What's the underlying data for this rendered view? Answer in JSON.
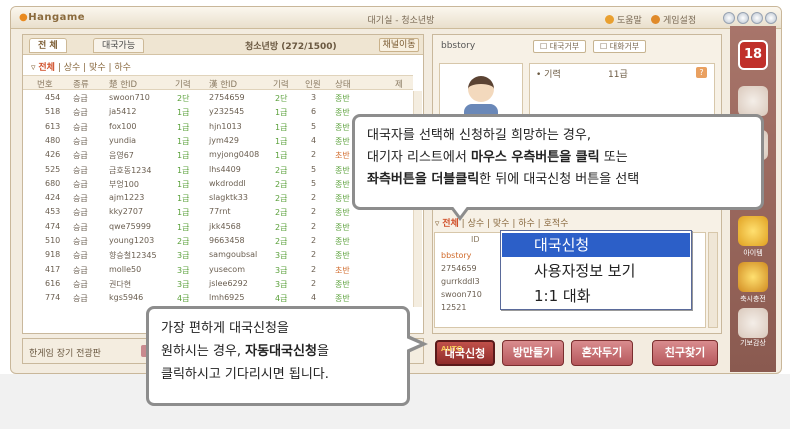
{
  "window": {
    "logo": "Hangame",
    "title": "대기실 - 청소년방",
    "help_link": "도움말",
    "settings_link": "게임설정"
  },
  "left_panel": {
    "tabs": [
      "전 체",
      "대국가능"
    ],
    "room_label": "청소년방 (272/1500)",
    "channel_button": "채널이동",
    "filter": {
      "all": "전체",
      "items": [
        "상수",
        "맞수",
        "하수"
      ]
    },
    "columns": [
      "번호",
      "종류",
      "楚 한ID",
      "기력",
      "漢 한ID",
      "기력",
      "인원",
      "상태",
      "제"
    ],
    "rows": [
      [
        "454",
        "승급",
        "swoon710",
        "2단",
        "2754659",
        "2단",
        "3",
        "종반"
      ],
      [
        "518",
        "승급",
        "ja5412",
        "1급",
        "y232545",
        "1급",
        "6",
        "종반"
      ],
      [
        "613",
        "승급",
        "fox100",
        "1급",
        "hjn1013",
        "1급",
        "5",
        "종반"
      ],
      [
        "480",
        "승급",
        "yundia",
        "1급",
        "jym429",
        "1급",
        "4",
        "종반"
      ],
      [
        "426",
        "승급",
        "음영67",
        "1급",
        "myjong0408",
        "1급",
        "2",
        "초반"
      ],
      [
        "525",
        "승급",
        "금호동1234",
        "1급",
        "lhs4409",
        "2급",
        "5",
        "종반"
      ],
      [
        "680",
        "승급",
        "부엉100",
        "1급",
        "wkdroddl",
        "2급",
        "5",
        "종반"
      ],
      [
        "424",
        "승급",
        "ajm1223",
        "1급",
        "slagktk33",
        "2급",
        "2",
        "종반"
      ],
      [
        "453",
        "승급",
        "kky2707",
        "1급",
        "77rnt",
        "2급",
        "2",
        "종반"
      ],
      [
        "474",
        "승급",
        "qwe75999",
        "1급",
        "jkk4568",
        "2급",
        "2",
        "종반"
      ],
      [
        "510",
        "승급",
        "young1203",
        "2급",
        "9663458",
        "2급",
        "2",
        "종반"
      ],
      [
        "918",
        "승급",
        "향승철12345",
        "3급",
        "samgoubsal",
        "3급",
        "2",
        "종반"
      ],
      [
        "417",
        "승급",
        "molle50",
        "3급",
        "yusecom",
        "3급",
        "2",
        "초반"
      ],
      [
        "616",
        "승급",
        "권다현",
        "3급",
        "jslee6292",
        "3급",
        "2",
        "종반"
      ],
      [
        "774",
        "승급",
        "kgs5946",
        "4급",
        "lmh6925",
        "4급",
        "4",
        "종반"
      ]
    ],
    "chat_label": "한게임 장기 전광판"
  },
  "right_panel": {
    "username": "bbstory",
    "reject_game": "대국거부",
    "reject_chat": "대화거부",
    "level_label": "기력",
    "level_value": "11급",
    "user_tabs": {
      "all": "전체",
      "items": [
        "상수",
        "맞수",
        "하수",
        "호적수"
      ]
    },
    "user_header": "ID",
    "users": [
      "bbstory",
      "2754659",
      "gurrkddl3",
      "swoon710",
      "12521"
    ]
  },
  "context_menu": [
    "대국신청",
    "사용자정보 보기",
    "1:1 대화"
  ],
  "buttons": {
    "auto_tag": "AUTO",
    "apply": "대국신청",
    "create_room": "방만들기",
    "solo": "혼자두기",
    "find_friend": "친구찾기"
  },
  "sidebar": [
    "아이템",
    "축시충전",
    "기보감상"
  ],
  "callout_top": {
    "line1": "대국자를 선택해 신청하길 희망하는 경우,",
    "line2_pre": "대기자 리스트에서 ",
    "line2_bold": "마우스 우측버튼을 클릭",
    "line2_post": " 또는",
    "line3_bold": "좌측버튼을 더블클릭",
    "line3_post": "한 뒤에 대국신청 버튼을 선택"
  },
  "callout_bottom": {
    "line1": "가장 편하게 대국신청을",
    "line2_pre": "원하시는 경우, ",
    "line2_bold": "자동대국신청",
    "line2_post": "을",
    "line3": "클릭하시고 기다리시면 됩니다."
  }
}
